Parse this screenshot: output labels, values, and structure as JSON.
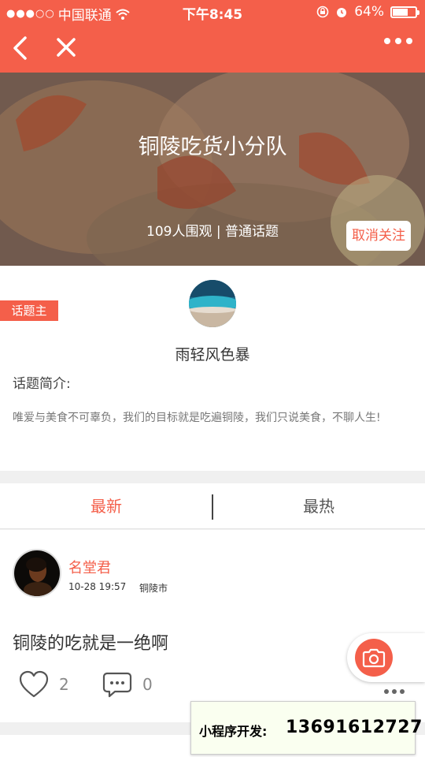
{
  "status_bar": {
    "carrier": "中国联通",
    "time": "下午8:45",
    "battery_percent": "64%",
    "battery_level": 0.64
  },
  "topic": {
    "title": "铜陵吃货小分队",
    "meta": "109人围观 | 普通话题",
    "unfollow_label": "取消关注"
  },
  "owner": {
    "tag": "话题主",
    "name": "雨轻风色暴",
    "intro_label": "话题简介:",
    "intro_text": "唯爱与美食不可辜负，我们的目标就是吃遍铜陵，我们只说美食，不聊人生!"
  },
  "tabs": [
    {
      "label": "最新",
      "active": true
    },
    {
      "label": "最热",
      "active": false
    }
  ],
  "post": {
    "author": "名堂君",
    "time": "10-28 19:57",
    "city": "铜陵市",
    "body": "铜陵的吃就是一绝啊",
    "likes": "2",
    "comments": "0"
  },
  "ad": {
    "label": "小程序开发:",
    "phone": "13691612727"
  },
  "colors": {
    "accent": "#f45f4a"
  }
}
